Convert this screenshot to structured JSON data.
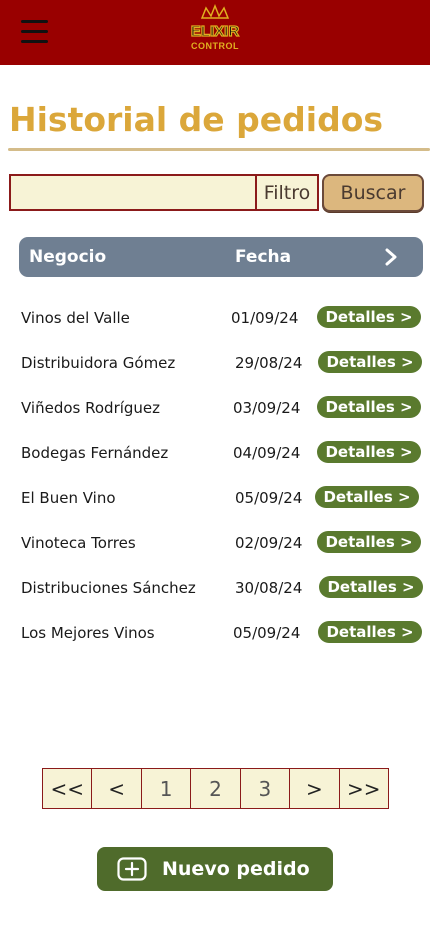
{
  "header": {
    "logo_text": "CONTROL",
    "logo_word": "ELIXIR"
  },
  "page": {
    "title": "Historial de pedidos"
  },
  "search": {
    "value": "",
    "placeholder": "",
    "filter_label": "Filtro",
    "button_label": "Buscar"
  },
  "table": {
    "columns": [
      "Negocio",
      "Fecha"
    ],
    "rows": [
      {
        "name": "Vinos del Valle",
        "date": "01/09/24",
        "details": "Detalles >"
      },
      {
        "name": "Distribuidora Gómez",
        "date": "29/08/24",
        "details": "Detalles >"
      },
      {
        "name": "Viñedos Rodríguez",
        "date": "03/09/24",
        "details": "Detalles >"
      },
      {
        "name": "Bodegas Fernández",
        "date": "04/09/24",
        "details": "Detalles >"
      },
      {
        "name": "El Buen Vino",
        "date": "05/09/24",
        "details": "Detalles >"
      },
      {
        "name": "Vinoteca Torres",
        "date": "02/09/24",
        "details": "Detalles >"
      },
      {
        "name": "Distribuciones Sánchez",
        "date": "30/08/24",
        "details": "Detalles >"
      },
      {
        "name": "Los Mejores Vinos",
        "date": "05/09/24",
        "details": "Detalles >"
      }
    ]
  },
  "pagination": {
    "first": "<<",
    "prev": "<",
    "pages": [
      "1",
      "2",
      "3"
    ],
    "next": ">",
    "last": ">>"
  },
  "actions": {
    "new_order_label": "Nuevo pedido"
  },
  "colors": {
    "header_bg": "#990000",
    "title": "#dba73a",
    "table_header": "#6f7f92",
    "details_button": "#5a7a2e",
    "new_order_button": "#4f6b2b",
    "input_bg": "#f7f3d6",
    "search_button": "#dcb77e"
  },
  "icons": {
    "menu": "hamburger-icon",
    "logo": "crown-logo",
    "table_next": "chevron-right-icon",
    "new_order": "plus-square-icon"
  }
}
